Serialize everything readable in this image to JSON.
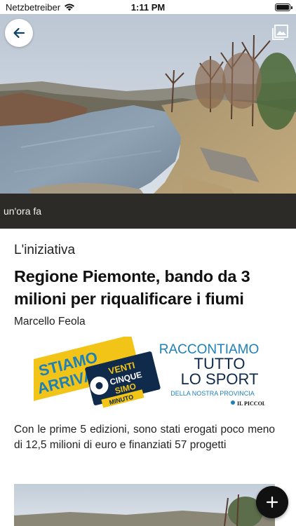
{
  "status_bar": {
    "carrier": "Netzbetreiber",
    "time": "1:11 PM",
    "battery_level": 1.0,
    "icons": [
      "wifi-icon",
      "battery-icon"
    ]
  },
  "hero": {
    "relative_time": "un'ora fa",
    "icons": [
      "back-arrow-icon",
      "gallery-icon"
    ]
  },
  "article": {
    "kicker": "L'iniziativa",
    "title": "Regione Piemonte, bando da 3 milioni per riqualificare i fiumi",
    "author": "Marcello Feola",
    "summary": "Con le prime 5 edizioni, sono stati erogati poco meno di 12,5 milioni di euro e finanziati 57 progetti"
  },
  "ad": {
    "stiamo": "STIAMO",
    "arrivando": "ARRIVANDO",
    "venti": "VENTI",
    "cinque": "CINQUE",
    "simo": "SIMO",
    "minuto": "MINUTO",
    "line1": "RACCONTIAMO",
    "line2": "TUTTO",
    "line3": "LO SPORT",
    "line4": "DELLA NOSTRA PROVINCIA",
    "logo_text": "IL PICCOLO",
    "colors": {
      "yellow": "#f2c417",
      "blue": "#1f80b8",
      "navy": "#0f2a4a"
    }
  },
  "fab": {
    "icon": "plus-icon"
  }
}
